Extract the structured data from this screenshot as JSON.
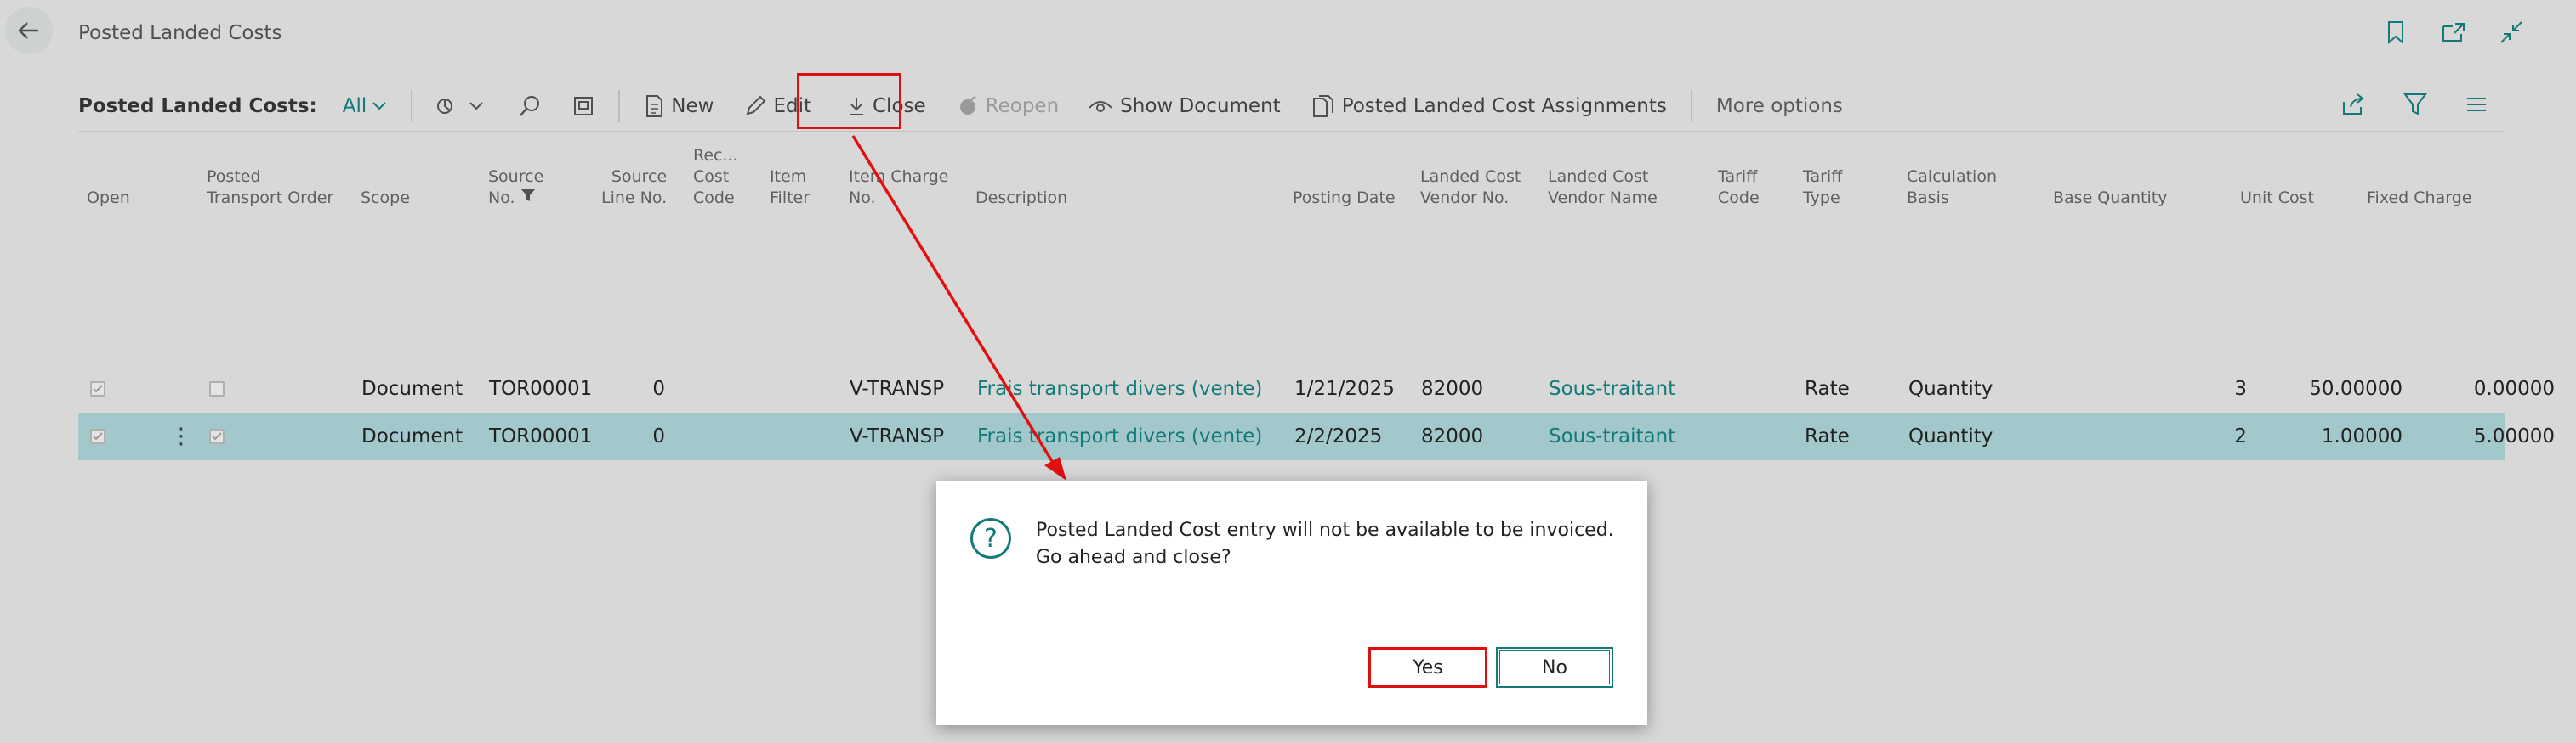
{
  "header": {
    "title": "Posted Landed Costs"
  },
  "actionbar": {
    "label": "Posted Landed Costs:",
    "filter": "All",
    "new_label": "New",
    "edit_label": "Edit",
    "close_label": "Close",
    "reopen_label": "Reopen",
    "show_document_label": "Show Document",
    "assignments_label": "Posted Landed Cost Assignments",
    "more_options_label": "More options"
  },
  "columns": {
    "open": "Open",
    "posted_transport_order": [
      "Posted",
      "Transport Order"
    ],
    "scope": "Scope",
    "source_no": [
      "Source",
      "No."
    ],
    "source_line_no": [
      "Source",
      "Line No."
    ],
    "rec_cost_code": [
      "Rec...",
      "Cost",
      "Code"
    ],
    "item_filter": [
      "Item",
      "Filter"
    ],
    "item_charge_no": [
      "Item Charge",
      "No."
    ],
    "description": "Description",
    "posting_date": "Posting Date",
    "landed_cost_vendor_no": [
      "Landed Cost",
      "Vendor No."
    ],
    "landed_cost_vendor_name": [
      "Landed Cost",
      "Vendor Name"
    ],
    "tariff_code": [
      "Tariff",
      "Code"
    ],
    "tariff_type": [
      "Tariff",
      "Type"
    ],
    "calculation_basis": [
      "Calculation",
      "Basis"
    ],
    "base_quantity": "Base Quantity",
    "unit_cost": "Unit Cost",
    "fixed_charge": "Fixed Charge"
  },
  "rows": [
    {
      "scope": "Document",
      "source_no": "TOR00001",
      "source_line_no": "0",
      "item_charge_no": "V-TRANSP",
      "description": "Frais transport divers (vente)",
      "posting_date": "1/21/2025",
      "vendor_no": "82000",
      "vendor_name": "Sous-traitant",
      "tariff_type": "Rate",
      "calculation_basis": "Quantity",
      "base_quantity": "3",
      "unit_cost": "50.00000",
      "fixed_charge": "0.00000"
    },
    {
      "scope": "Document",
      "source_no": "TOR00001",
      "source_line_no": "0",
      "item_charge_no": "V-TRANSP",
      "description": "Frais transport divers (vente)",
      "posting_date": "2/2/2025",
      "vendor_no": "82000",
      "vendor_name": "Sous-traitant",
      "tariff_type": "Rate",
      "calculation_basis": "Quantity",
      "base_quantity": "2",
      "unit_cost": "1.00000",
      "fixed_charge": "5.00000"
    }
  ],
  "dialog": {
    "message": "Posted Landed Cost entry will not be available to be invoiced. Go ahead and close?",
    "yes_label": "Yes",
    "no_label": "No"
  },
  "colors": {
    "accent": "#137a7a",
    "highlight": "#dd1111",
    "selected_row": "#a3c8cc"
  }
}
